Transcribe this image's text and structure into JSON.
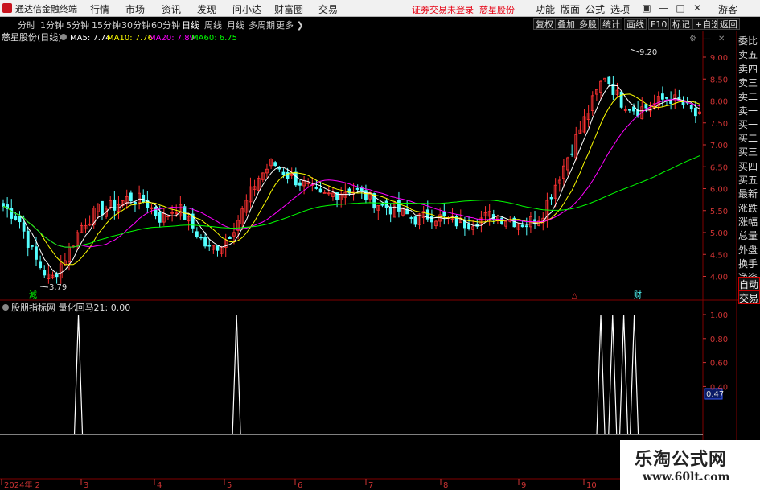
{
  "menubar": {
    "app_title": "通达信金融终端",
    "menus": [
      "行情",
      "市场",
      "资讯",
      "发现",
      "问小达",
      "财富圈",
      "交易"
    ],
    "notice_login": "证券交易未登录",
    "notice_stock": "慈星股份",
    "right_menus": [
      "功能",
      "版面",
      "公式",
      "选项"
    ],
    "guest": "游客",
    "win_buttons": [
      "▣",
      "—",
      "□",
      "✕"
    ]
  },
  "toolbar": {
    "periods": [
      "分时",
      "1分钟",
      "5分钟",
      "15分钟",
      "30分钟",
      "60分钟",
      "日线",
      "周线",
      "月线",
      "多周期",
      "更多"
    ],
    "active_period": "日线",
    "buttons": [
      "复权",
      "叠加",
      "多股",
      "统计",
      "画线",
      "F10",
      "标记",
      "+自选",
      "返回"
    ]
  },
  "main_chart": {
    "stock_label": "慈星股份(日线)",
    "ma5_label": "MA5: 7.74",
    "ma10_label": "MA10: 7.76",
    "ma20_label": "MA20: 7.89",
    "ma60_label": "MA60: 6.75",
    "high_annotation": "9.20",
    "low_annotation": "3.79",
    "buy_marker": "減",
    "finance_marker": "财",
    "event_marker": "△",
    "y_ticks": [
      "9.00",
      "8.50",
      "8.00",
      "7.50",
      "7.00",
      "6.50",
      "6.00",
      "5.50",
      "5.00",
      "4.50",
      "4.00"
    ]
  },
  "sub_chart": {
    "indicator_label": "股朋指标网 量化回马21: 0.00",
    "y_ticks": [
      "1.00",
      "0.80",
      "0.60",
      "0.40"
    ],
    "cursor_value": "0.47"
  },
  "x_axis": {
    "labels": [
      "2024年 2",
      "3",
      "4",
      "5",
      "6",
      "7",
      "8",
      "9",
      "10"
    ]
  },
  "sidepanel": {
    "items": [
      "委比",
      "卖五",
      "卖四",
      "卖三",
      "卖二",
      "卖一",
      "买一",
      "买二",
      "买三",
      "买四",
      "买五",
      "最新",
      "涨跌",
      "涨幅",
      "总量",
      "外盘",
      "换手",
      "净资",
      "收益",
      "自动",
      "交易"
    ]
  },
  "watermark": {
    "title": "乐淘公式网",
    "url": "www.60lt.com"
  },
  "colors": {
    "up": "#ff3232",
    "down": "#54ffff",
    "ma5": "#ffffff",
    "ma10": "#ffff00",
    "ma20": "#ff00ff",
    "ma60": "#00ff00",
    "grid": "#800000",
    "signal": "#ffffff"
  },
  "chart_data": {
    "type": "candlestick",
    "title": "慈星股份(日线)",
    "x_labels": [
      "2024年 2",
      "3",
      "4",
      "5",
      "6",
      "7",
      "8",
      "9",
      "10"
    ],
    "price_range": [
      3.6,
      9.5
    ],
    "price_high": 9.2,
    "price_low": 3.79,
    "ma_close": {
      "MA5": 7.74,
      "MA10": 7.76,
      "MA20": 7.89,
      "MA60": 6.75
    },
    "price_path": [
      5.6,
      5.3,
      4.4,
      3.9,
      4.5,
      5.2,
      5.5,
      5.6,
      5.8,
      5.7,
      5.3,
      5.6,
      5.1,
      4.6,
      4.8,
      5.4,
      6.2,
      6.6,
      6.3,
      6.1,
      5.8,
      5.9,
      6.0,
      5.8,
      5.6,
      5.5,
      5.3,
      5.4,
      5.3,
      5.2,
      5.3,
      5.4,
      5.3,
      5.2,
      5.4,
      6.2,
      7.0,
      7.8,
      8.6,
      8.0,
      7.8,
      7.9,
      8.1,
      7.9,
      7.6
    ],
    "indicator": {
      "name": "量化回马21",
      "range": [
        0,
        1
      ],
      "current": 0.0,
      "signal_positions": [
        0.108,
        0.335,
        0.858,
        0.875,
        0.891,
        0.906
      ]
    }
  }
}
